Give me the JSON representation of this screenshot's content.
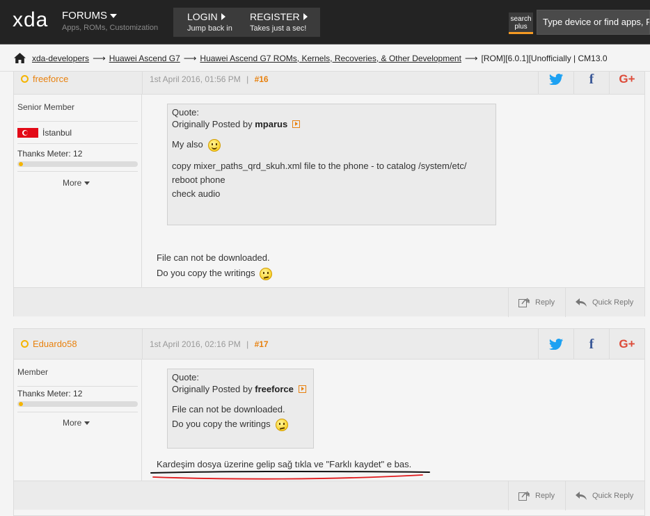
{
  "header": {
    "logo": "xda",
    "forums": {
      "title": "FORUMS",
      "subtitle": "Apps, ROMs, Customization"
    },
    "login": {
      "title": "LOGIN",
      "subtitle": "Jump back in"
    },
    "register": {
      "title": "REGISTER",
      "subtitle": "Takes just a sec!"
    },
    "search_plus": {
      "line1": "search",
      "line2": "plus"
    },
    "search_placeholder": "Type device or find apps, R"
  },
  "breadcrumb": {
    "items": [
      "xda-developers",
      "Huawei Ascend G7",
      "Huawei Ascend G7 ROMs, Kernels, Recoveries, & Other Development"
    ],
    "current": "[ROM][6.0.1][Unofficially | CM13.0"
  },
  "posts": [
    {
      "username": "freeforce",
      "date": "1st April 2016, 01:56 PM",
      "separator": "|",
      "number": "#16",
      "rank": "Senior Member",
      "location": "İstanbul",
      "thanks": "Thanks Meter: 12",
      "thanks_meter_level": 0.04,
      "more": "More",
      "quote": {
        "label": "Quote:",
        "by_prefix": "Originally Posted by",
        "author": "mparus",
        "lines": [
          "My also",
          "copy mixer_paths_qrd_skuh.xml file to the phone - to catalog /system/etc/",
          "reboot phone",
          "check audio"
        ]
      },
      "body": [
        "File can not be downloaded.",
        "Do you copy the writings"
      ],
      "reply": "Reply",
      "quick_reply": "Quick Reply"
    },
    {
      "username": "Eduardo58",
      "date": "1st April 2016, 02:16 PM",
      "separator": "|",
      "number": "#17",
      "rank": "Member",
      "thanks": "Thanks Meter: 12",
      "thanks_meter_level": 0.04,
      "more": "More",
      "quote": {
        "label": "Quote:",
        "by_prefix": "Originally Posted by",
        "author": "freeforce",
        "lines": [
          "File can not be downloaded.",
          "Do you copy the writings"
        ]
      },
      "body": [
        "Kardeşim dosya üzerine gelip sağ tıkla ve \"Farklı kaydet\" e bas."
      ],
      "reply": "Reply",
      "quick_reply": "Quick Reply"
    }
  ],
  "colors": {
    "accent_orange": "#e8810e",
    "status_ring": "#f5b400",
    "twitter": "#1da1f2",
    "facebook": "#3b5998",
    "google_plus": "#dd4b39",
    "annotation_black": "#111111",
    "annotation_red": "#e0181b"
  }
}
